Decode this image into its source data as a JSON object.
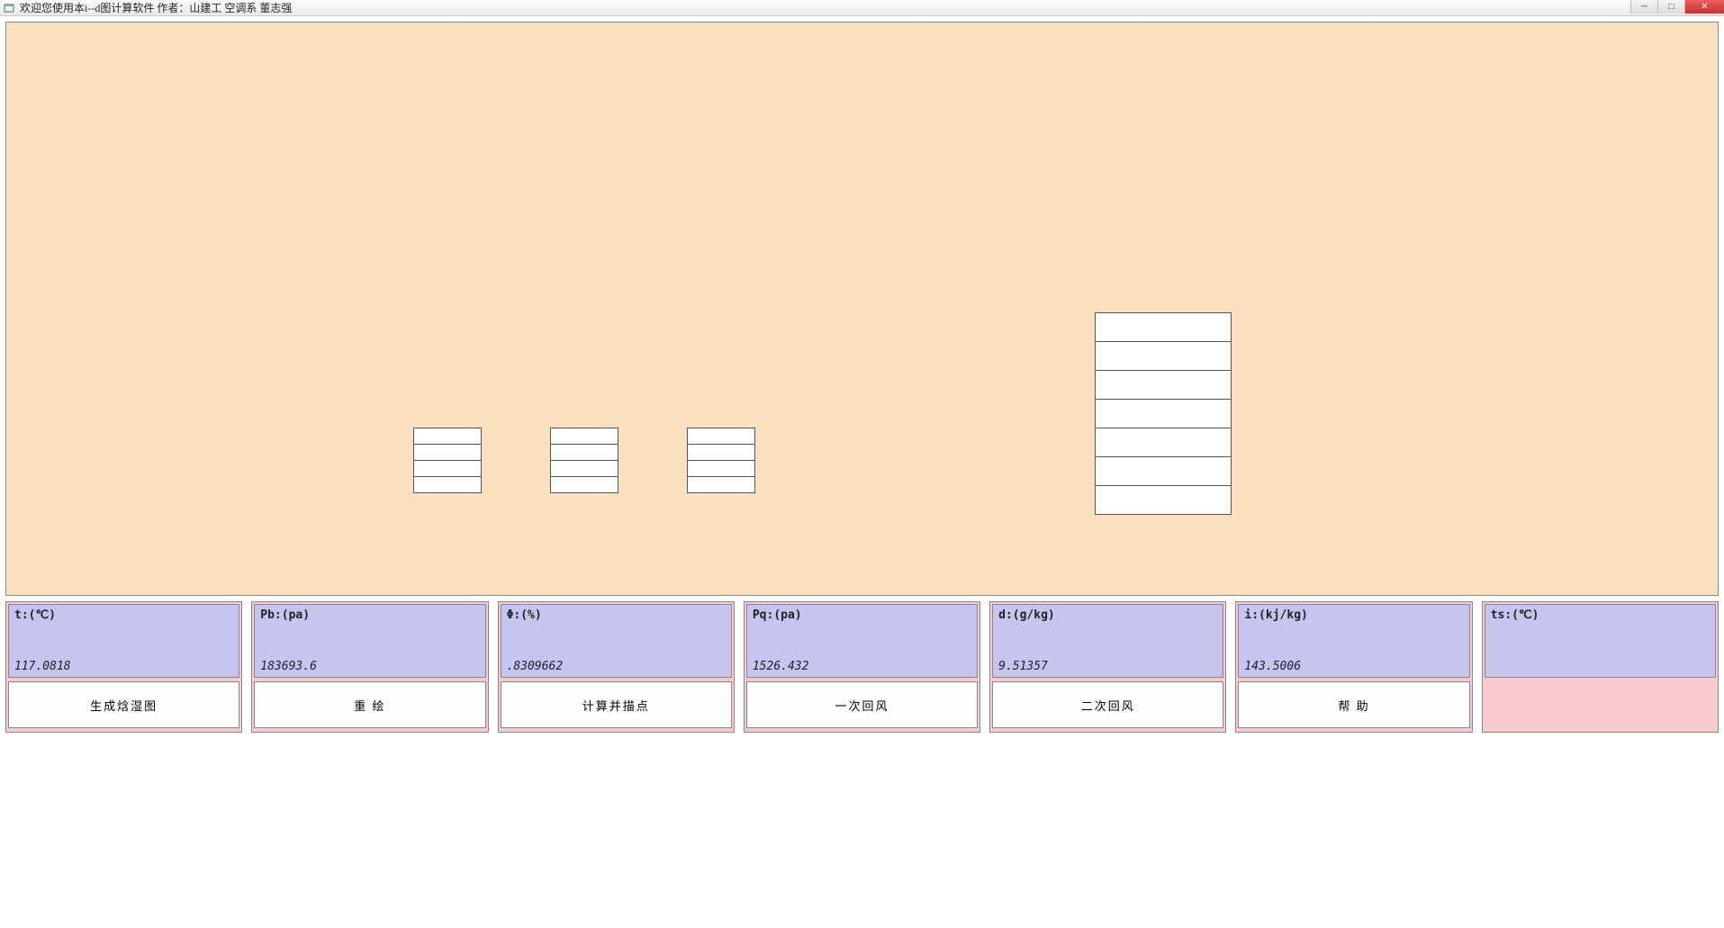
{
  "window": {
    "title": "欢迎您使用本i--d图计算软件     作者：山建工 空调系 董志强"
  },
  "params": [
    {
      "label": "t:(℃)",
      "value": "117.0818"
    },
    {
      "label": "Pb:(pa)",
      "value": "183693.6"
    },
    {
      "label": "Φ:(%)",
      "value": ".8309662"
    },
    {
      "label": "Pq:(pa)",
      "value": "1526.432"
    },
    {
      "label": "d:(g/kg)",
      "value": "9.51357"
    },
    {
      "label": "i:(kj/kg)",
      "value": "143.5006"
    },
    {
      "label": "ts:(℃)",
      "value": ""
    }
  ],
  "buttons": {
    "generate": "生成焓湿图",
    "redraw": "重     绘",
    "calc": "计算并描点",
    "return1": "一次回风",
    "return2": "二次回风",
    "help": "帮     助"
  },
  "stacks": {
    "a": [
      "",
      "",
      "",
      ""
    ],
    "b": [
      "",
      "",
      "",
      ""
    ],
    "c": [
      "",
      "",
      "",
      ""
    ],
    "r": [
      "",
      "",
      "",
      "",
      "",
      "",
      ""
    ]
  }
}
